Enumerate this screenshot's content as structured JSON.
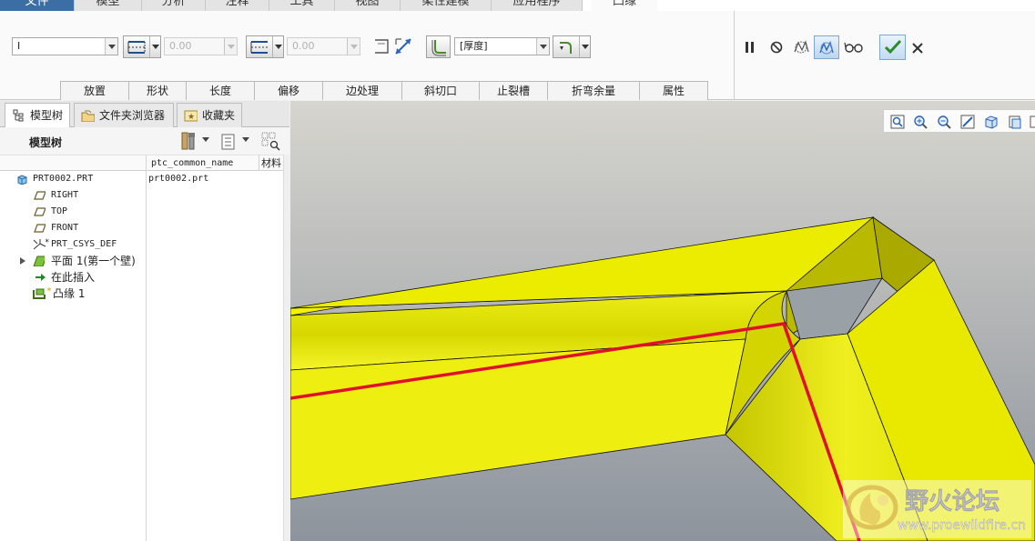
{
  "menu": {
    "tabs": [
      {
        "label": "文件",
        "w": 0
      },
      {
        "label": "模型"
      },
      {
        "label": "分析"
      },
      {
        "label": "注释"
      },
      {
        "label": "工具"
      },
      {
        "label": "视图"
      },
      {
        "label": "柔性建模"
      },
      {
        "label": "应用程序"
      },
      {
        "label": "凸缘"
      }
    ]
  },
  "ribbon": {
    "shape_combo": "I",
    "length1_value": "0.00",
    "length2_value": "0.00",
    "thickness_combo": "[厚度]",
    "subtabs": [
      "放置",
      "形状",
      "长度",
      "偏移",
      "边处理",
      "斜切口",
      "止裂槽",
      "折弯余量",
      "属性"
    ]
  },
  "panel": {
    "tabs": [
      "模型树",
      "文件夹浏览器",
      "收藏夹"
    ],
    "tree_title": "模型树",
    "columns": [
      "ptc_common_name",
      "材料"
    ],
    "rows": [
      {
        "label": "PRT0002.PRT",
        "value": "prt0002.prt"
      },
      {
        "label": "RIGHT"
      },
      {
        "label": "TOP"
      },
      {
        "label": "FRONT"
      },
      {
        "label": "PRT_CSYS_DEF"
      },
      {
        "label": "平面 1(第一个壁)"
      },
      {
        "label": "在此插入"
      },
      {
        "label": "凸缘 1"
      }
    ],
    "csys_mark": "*",
    "new_mark": "*"
  },
  "watermark": {
    "title": "野火论坛",
    "url": "www.proewildfire.cn"
  },
  "colors": {
    "accent": "#3b6ea5",
    "model_yellow": "#f0f000",
    "edge_red": "#e0102a",
    "viewport_top": "#d6d5cf",
    "viewport_bottom": "#8d949d"
  }
}
